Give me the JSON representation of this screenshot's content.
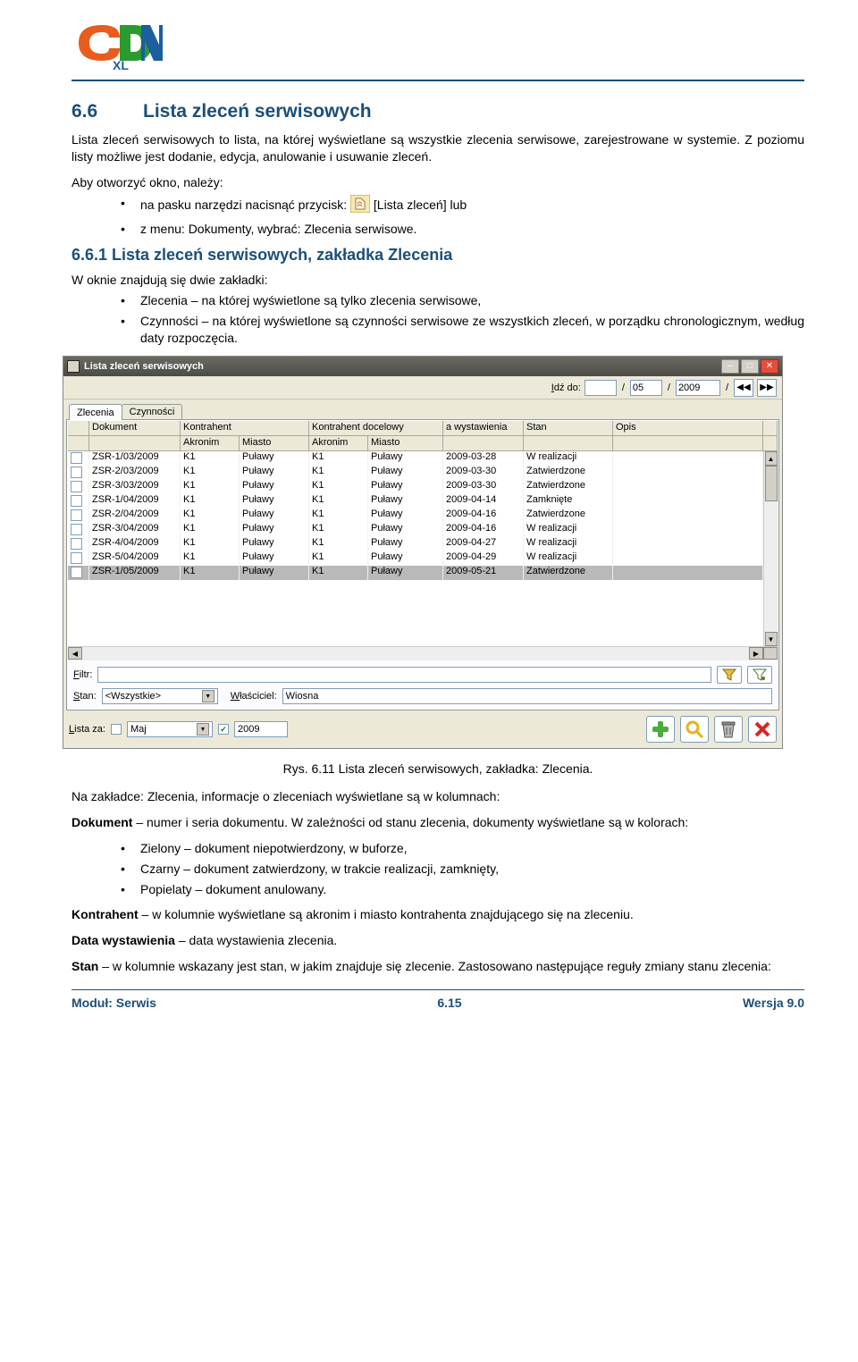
{
  "logo_text": "CDN XL",
  "section": {
    "number": "6.6",
    "title": "Lista zleceń serwisowych"
  },
  "p1": "Lista zleceń serwisowych to lista, na której wyświetlane są wszystkie zlecenia serwisowe, zarejestrowane w systemie. Z poziomu listy możliwe jest dodanie, edycja, anulowanie i usuwanie zleceń.",
  "open_line": "Aby otworzyć okno, należy:",
  "open_b1_a": "na pasku narzędzi nacisnąć przycisk: ",
  "open_b1_b": " [Lista zleceń] lub",
  "open_b2": "z menu: Dokumenty, wybrać: Zlecenia serwisowe.",
  "subsection": "6.6.1 Lista zleceń serwisowych, zakładka Zlecenia",
  "sub_intro": "W oknie znajdują się dwie zakładki:",
  "sub_b1": "Zlecenia – na której wyświetlone są tylko zlecenia serwisowe,",
  "sub_b2": "Czynności – na której wyświetlone są czynności serwisowe ze wszystkich zleceń, w porządku chronologicznym, według daty rozpoczęcia.",
  "window": {
    "title": "Lista zleceń serwisowych",
    "go_label": "Idź do:",
    "month": "05",
    "year": "2009",
    "tabs": [
      "Zlecenia",
      "Czynności"
    ],
    "head1": [
      "",
      "Dokument",
      "Kontrahent",
      "",
      "Kontrahent docelowy",
      "",
      "a wystawienia",
      "Stan",
      "Opis",
      ""
    ],
    "head2": [
      "",
      "",
      "Akronim",
      "Miasto",
      "Akronim",
      "Miasto",
      "",
      "",
      "",
      ""
    ],
    "rows": [
      [
        "ZSR-1/03/2009",
        "K1",
        "Puławy",
        "K1",
        "Puławy",
        "2009-03-28",
        "W realizacji",
        ""
      ],
      [
        "ZSR-2/03/2009",
        "K1",
        "Puławy",
        "K1",
        "Puławy",
        "2009-03-30",
        "Zatwierdzone",
        ""
      ],
      [
        "ZSR-3/03/2009",
        "K1",
        "Puławy",
        "K1",
        "Puławy",
        "2009-03-30",
        "Zatwierdzone",
        ""
      ],
      [
        "ZSR-1/04/2009",
        "K1",
        "Puławy",
        "K1",
        "Puławy",
        "2009-04-14",
        "Zamknięte",
        ""
      ],
      [
        "ZSR-2/04/2009",
        "K1",
        "Puławy",
        "K1",
        "Puławy",
        "2009-04-16",
        "Zatwierdzone",
        ""
      ],
      [
        "ZSR-3/04/2009",
        "K1",
        "Puławy",
        "K1",
        "Puławy",
        "2009-04-16",
        "W realizacji",
        ""
      ],
      [
        "ZSR-4/04/2009",
        "K1",
        "Puławy",
        "K1",
        "Puławy",
        "2009-04-27",
        "W realizacji",
        ""
      ],
      [
        "ZSR-5/04/2009",
        "K1",
        "Puławy",
        "K1",
        "Puławy",
        "2009-04-29",
        "W realizacji",
        ""
      ],
      [
        "ZSR-1/05/2009",
        "K1",
        "Puławy",
        "K1",
        "Puławy",
        "2009-05-21",
        "Zatwierdzone",
        ""
      ]
    ],
    "filter_label": "Filtr:",
    "status_label": "Stan:",
    "status_value": "<Wszystkie>",
    "owner_label": "Właściciel:",
    "owner_value": "Wiosna",
    "listfor_label": "Lista za:",
    "month_name": "Maj",
    "year_value": "2009"
  },
  "caption": "Rys. 6.11 Lista zleceń serwisowych, zakładka: Zlecenia.",
  "after1": "Na zakładce: Zlecenia, informacje o zleceniach wyświetlane są w kolumnach:",
  "doc_label": "Dokument",
  "doc_desc": " – numer i seria dokumentu. W zależności od stanu zlecenia, dokumenty wyświetlane są w kolorach:",
  "colors_b1": "Zielony – dokument niepotwierdzony, w buforze,",
  "colors_b2": "Czarny – dokument zatwierdzony, w trakcie realizacji, zamknięty,",
  "colors_b3": "Popielaty – dokument anulowany.",
  "kontrahent_label": "Kontrahent",
  "kontrahent": " – w kolumnie wyświetlane są akronim i miasto kontrahenta znajdującego się na zleceniu.",
  "data_label": "Data wystawienia",
  "data_w": " – data wystawienia zlecenia.",
  "stan_label": "Stan",
  "stan": " – w kolumnie wskazany jest stan, w jakim znajduje się zlecenie. Zastosowano następujące reguły zmiany stanu zlecenia:",
  "footer": {
    "left": "Moduł: Serwis",
    "center": "6.15",
    "right": "Wersja 9.0"
  }
}
